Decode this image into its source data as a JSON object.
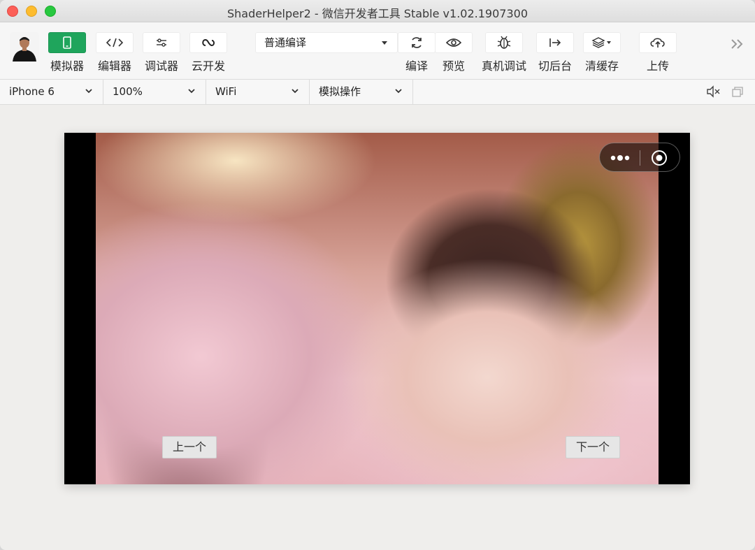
{
  "window": {
    "title": "ShaderHelper2 - 微信开发者工具 Stable v1.02.1907300"
  },
  "toolbar": {
    "simulator_label": "模拟器",
    "editor_label": "编辑器",
    "debugger_label": "调试器",
    "cloud_label": "云开发",
    "compile_mode": "普通编译",
    "compile_label": "编译",
    "preview_label": "预览",
    "remote_debug_label": "真机调试",
    "background_label": "切后台",
    "clear_cache_label": "清缓存",
    "upload_label": "上传"
  },
  "subbar": {
    "device": "iPhone 6",
    "zoom": "100%",
    "network": "WiFi",
    "simulate_ops": "模拟操作"
  },
  "simulator": {
    "prev_button": "上一个",
    "next_button": "下一个"
  },
  "colors": {
    "accent_green": "#1fa55c",
    "window_bg": "#efeeec"
  },
  "icons": [
    "phone-icon",
    "code-icon",
    "sliders-icon",
    "cloud-link-icon",
    "refresh-icon",
    "eye-icon",
    "bug-icon",
    "switch-out-icon",
    "layers-icon",
    "cloud-upload-icon",
    "double-chevron-icon",
    "mute-icon",
    "window-icon"
  ]
}
